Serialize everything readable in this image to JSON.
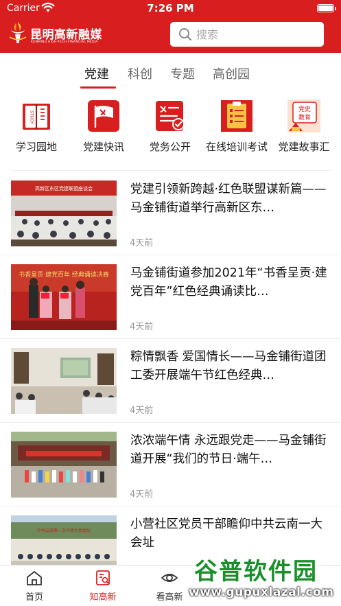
{
  "status_bar": {
    "carrier": "Carrier",
    "time": "7:26 PM"
  },
  "brand": {
    "name": "昆明高新融媒",
    "subtitle": "KUNMING HIGH-TECH FINANCIAL MEDIA"
  },
  "search": {
    "placeholder": "搜索"
  },
  "tabs": [
    {
      "label": "党建",
      "active": true
    },
    {
      "label": "科创"
    },
    {
      "label": "专题"
    },
    {
      "label": "高创园"
    }
  ],
  "categories": [
    {
      "label": "学习园地",
      "icon": "book-icon"
    },
    {
      "label": "党建快讯",
      "icon": "party-flag-icon"
    },
    {
      "label": "党务公开",
      "icon": "document-check-icon"
    },
    {
      "label": "在线培训考试",
      "icon": "clipboard-list-icon"
    },
    {
      "label": "党建故事汇",
      "icon": "party-history-icon",
      "badge": "党史教育"
    }
  ],
  "news": [
    {
      "title": "党建引领新跨越·红色联盟谋新篇——马金铺街道举行高新区东…",
      "time": "4天前",
      "banner": "高新区东区党建联盟座谈会"
    },
    {
      "title": "马金铺街道参加2021年“书香呈贡·建党百年”红色经典诵读比…",
      "time": "4天前",
      "banner": "书香呈贡·建党百年 经典诵读决赛"
    },
    {
      "title": "粽情飘香 爱国情长——马金铺街道团工委开展端午节红色经典…",
      "time": "4天前"
    },
    {
      "title": "浓浓端午情 永远跟党走——马金铺街道开展“我们的节日·端午…",
      "time": "4天前"
    },
    {
      "title": "小营社区党员干部瞻仰中共云南一大会址",
      "time": "",
      "banner": "中共云南第一次代表大会会址"
    }
  ],
  "bottom_nav": [
    {
      "label": "首页",
      "icon": "home-icon"
    },
    {
      "label": "知高新",
      "icon": "zhi-gaoxin-icon",
      "active": true
    },
    {
      "label": "看高新",
      "icon": "eye-icon"
    }
  ],
  "watermark": {
    "top": "谷普软件园",
    "bottom": "www.gupuxlazal.com"
  },
  "colors": {
    "brand_red": "#d81e1e",
    "watermark_green": "#1a8f2a"
  }
}
